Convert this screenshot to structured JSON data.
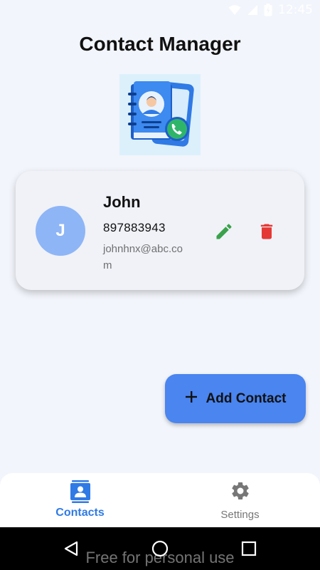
{
  "status_bar": {
    "time": "12:45",
    "icons": [
      "wifi-icon",
      "signal-icon",
      "battery-icon"
    ]
  },
  "header": {
    "title": "Contact Manager",
    "illustration": "contact-book-phone-illustration"
  },
  "contacts": [
    {
      "initial": "J",
      "name": "John",
      "phone": "897883943",
      "email": "johnhnx@abc.com",
      "actions": [
        "edit-icon",
        "delete-icon"
      ]
    }
  ],
  "fab": {
    "icon": "plus-icon",
    "label": "Add Contact"
  },
  "bottom_nav": {
    "items": [
      {
        "label": "Contacts",
        "icon": "contacts-icon",
        "active": true
      },
      {
        "label": "Settings",
        "icon": "gear-icon",
        "active": false
      }
    ]
  },
  "system_nav": {
    "buttons": [
      "back-icon",
      "home-icon",
      "recents-icon"
    ]
  },
  "watermark": "Free for personal use",
  "colors": {
    "background": "#f2f5fb",
    "card": "#f0f2f8",
    "avatar": "#8eb5f6",
    "accent_blue": "#4a85f0",
    "nav_active": "#2f7ae5",
    "edit_green": "#3aa24a",
    "delete_red": "#e53935"
  }
}
